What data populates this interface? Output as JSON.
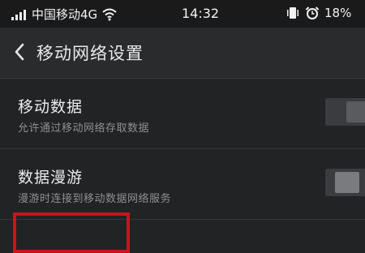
{
  "status_bar": {
    "carrier": "中国移动4G",
    "time": "14:32",
    "battery": "18%"
  },
  "header": {
    "title": "移动网络设置"
  },
  "settings": [
    {
      "title": "移动数据",
      "subtitle": "允许通过移动网络存取数据",
      "enabled": true
    },
    {
      "title": "数据漫游",
      "subtitle": "漫游时连接到移动数据网络服务",
      "enabled": false
    }
  ],
  "colors": {
    "background": "#222324",
    "toggle_on_accent": "#1fb66e",
    "highlight_border": "#c8141b"
  },
  "icons": [
    "signal-icon",
    "wifi-icon",
    "vibrate-icon",
    "alarm-icon",
    "back-arrow-icon"
  ]
}
